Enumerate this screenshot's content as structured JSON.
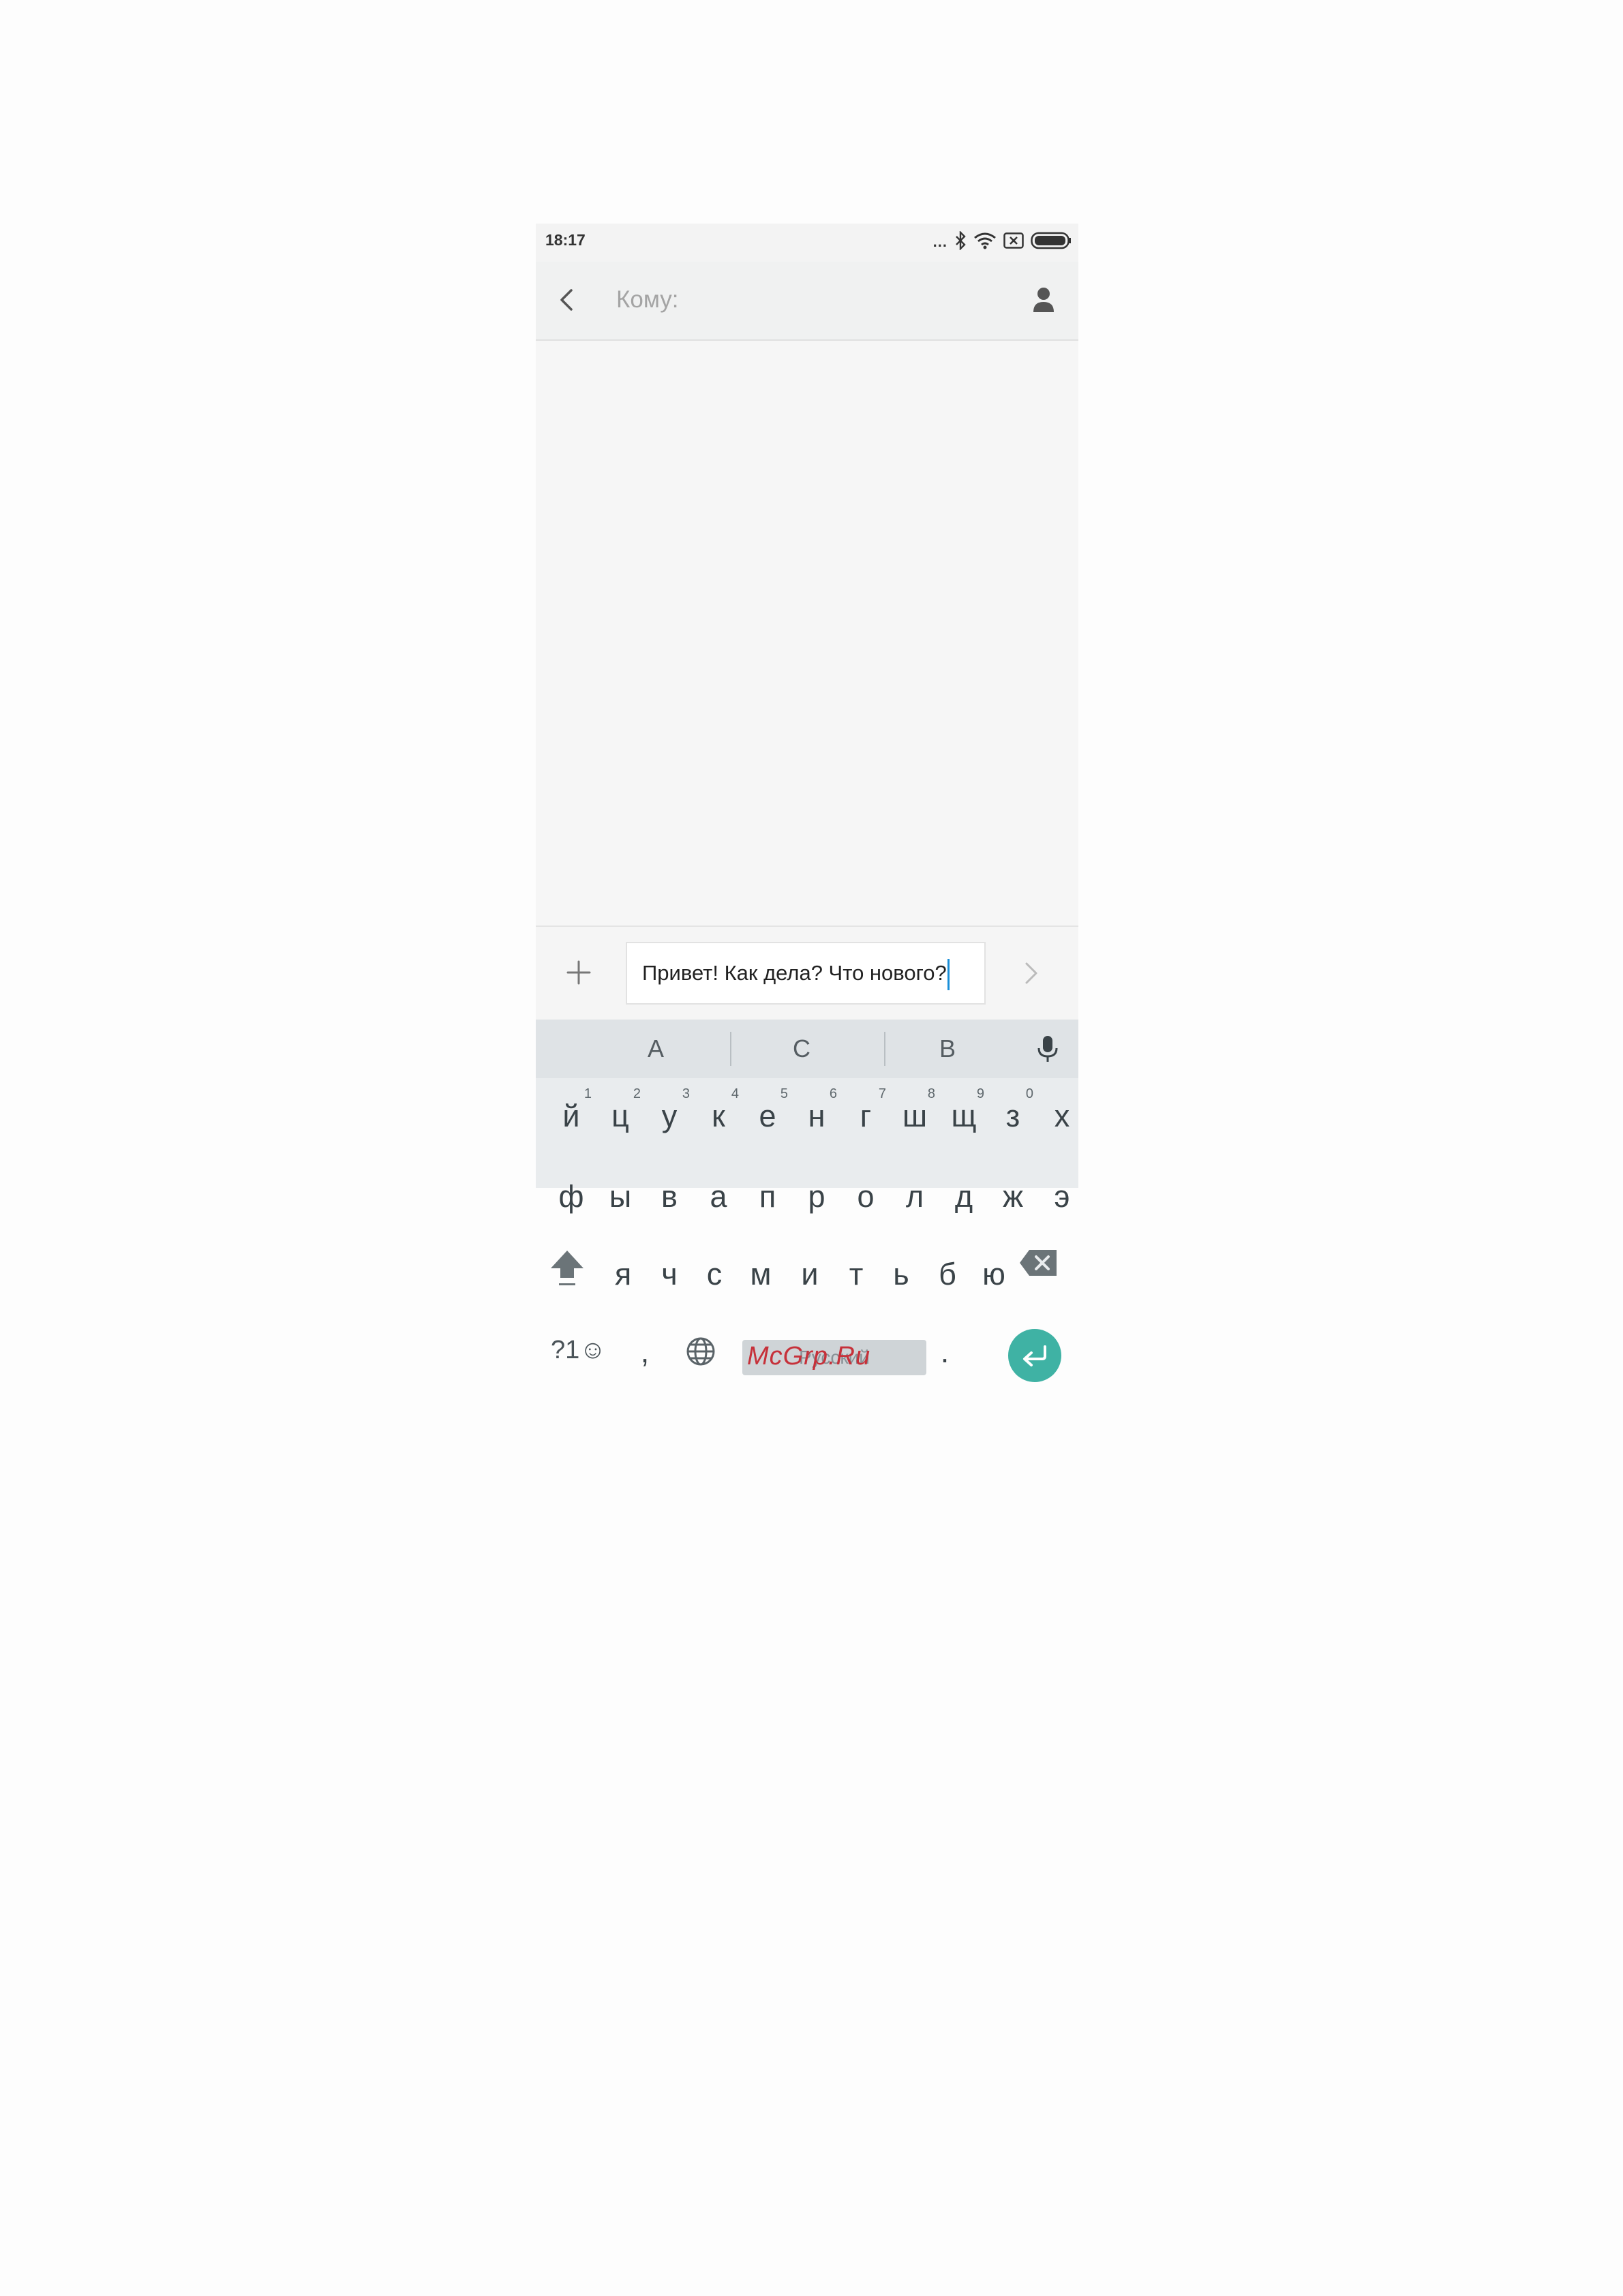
{
  "status_bar": {
    "time": "18:17",
    "dots": "...",
    "icons": [
      "bluetooth-icon",
      "wifi-icon",
      "no-sim-icon",
      "battery-icon"
    ]
  },
  "header": {
    "to_label": "Кому:",
    "back_icon": "chevron-left-icon",
    "contact_icon": "person-icon"
  },
  "compose": {
    "message_text": "Привет! Как дела? Что нового?",
    "attach_icon": "plus-icon",
    "send_icon": "chevron-right-icon"
  },
  "keyboard": {
    "suggestions": [
      "А",
      "С",
      "В"
    ],
    "row1": [
      {
        "k": "й",
        "h": "1"
      },
      {
        "k": "ц",
        "h": "2"
      },
      {
        "k": "у",
        "h": "3"
      },
      {
        "k": "к",
        "h": "4"
      },
      {
        "k": "е",
        "h": "5"
      },
      {
        "k": "н",
        "h": "6"
      },
      {
        "k": "г",
        "h": "7"
      },
      {
        "k": "ш",
        "h": "8"
      },
      {
        "k": "щ",
        "h": "9"
      },
      {
        "k": "з",
        "h": "0"
      },
      {
        "k": "х",
        "h": ""
      }
    ],
    "row2": [
      "ф",
      "ы",
      "в",
      "а",
      "п",
      "р",
      "о",
      "л",
      "д",
      "ж",
      "э"
    ],
    "row3": [
      "я",
      "ч",
      "с",
      "м",
      "и",
      "т",
      "ь",
      "б",
      "ю"
    ],
    "symbols_label": "?1☺",
    "comma": ",",
    "space_label": "Русский",
    "period": ".",
    "watermark": "McGrp.Ru",
    "accent_color": "#3fb2a4"
  }
}
